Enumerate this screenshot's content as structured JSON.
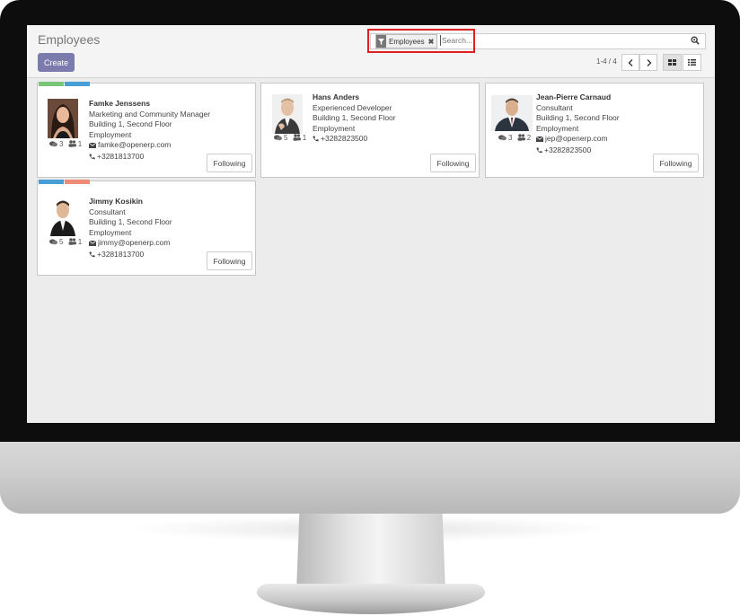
{
  "header": {
    "title": "Employees",
    "create_label": "Create"
  },
  "search": {
    "facet_label": "Employees",
    "placeholder": "Search...",
    "pager": "1-4 / 4"
  },
  "colors": {
    "create": "#7c7bad",
    "highlight": "#e02020",
    "tag_green": "#7ac678",
    "tag_blue": "#4a9ed6",
    "tag_salmon": "#ef8a76"
  },
  "employees": [
    {
      "name": "Famke Jenssens",
      "job": "Marketing and Community Manager",
      "location": "Building 1, Second Floor",
      "department": "Employment",
      "email": "famke@openerp.com",
      "phone": "+3281813700",
      "messages": "3",
      "followers": "1",
      "follow_label": "Following",
      "tags": [
        "tag_green",
        "tag_blue"
      ]
    },
    {
      "name": "Hans Anders",
      "job": "Experienced Developer",
      "location": "Building 1, Second Floor",
      "department": "Employment",
      "email": "",
      "phone": "+3282823500",
      "messages": "5",
      "followers": "1",
      "follow_label": "Following",
      "tags": []
    },
    {
      "name": "Jean-Pierre Carnaud",
      "job": "Consultant",
      "location": "Building 1, Second Floor",
      "department": "Employment",
      "email": "jep@openerp.com",
      "phone": "+3282823500",
      "messages": "3",
      "followers": "2",
      "follow_label": "Following",
      "tags": []
    },
    {
      "name": "Jimmy Kosikin",
      "job": "Consultant",
      "location": "Building 1, Second Floor",
      "department": "Employment",
      "email": "jimmy@openerp.com",
      "phone": "+3281813700",
      "messages": "5",
      "followers": "1",
      "follow_label": "Following",
      "tags": [
        "tag_blue",
        "tag_salmon"
      ]
    }
  ]
}
